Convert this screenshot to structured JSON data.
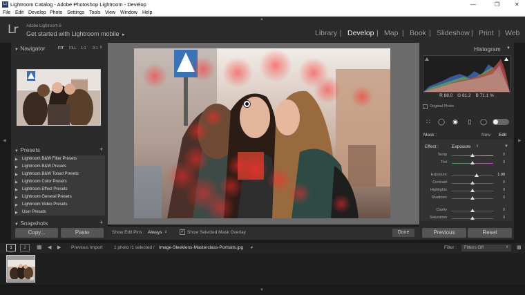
{
  "window": {
    "title": "Lightroom Catalog - Adobe Photoshop Lightroom - Develop",
    "app_icon": "Lr",
    "controls": [
      "minimize-icon",
      "restore-icon",
      "close-icon"
    ]
  },
  "menu": [
    "File",
    "Edit",
    "Develop",
    "Photo",
    "Settings",
    "Tools",
    "View",
    "Window",
    "Help"
  ],
  "identity": {
    "logo": "Lr",
    "version": "Adobe Lightroom 6",
    "mobile": "Get started with Lightroom mobile",
    "mobile_arrow": "▸"
  },
  "modules": {
    "library": "Library",
    "develop": "Develop",
    "map": "Map",
    "book": "Book",
    "slideshow": "Slideshow",
    "print": "Print",
    "web": "Web",
    "separator": "|"
  },
  "navigator": {
    "title": "Navigator",
    "fit": "FIT",
    "fill": "FILL",
    "one_to_one": "1:1",
    "ratio": "3:1"
  },
  "presets": {
    "title": "Presets",
    "items": [
      "Lightroom B&W Filter Presets",
      "Lightroom B&W Presets",
      "Lightroom B&W Toned Presets",
      "Lightroom Color Presets",
      "Lightroom Effect Presets",
      "Lightroom General Presets",
      "Lightroom Video Presets",
      "User Presets"
    ],
    "add": "+"
  },
  "snapshots": {
    "title": "Snapshots",
    "add": "+"
  },
  "left_buttons": {
    "copy": "Copy...",
    "paste": "Paste"
  },
  "toolbar": {
    "show_edit_pins_label": "Show Edit Pins :",
    "edit_pins_value": "Always",
    "overlay_label": "Show Selected Mask Overlay",
    "done": "Done"
  },
  "histogram": {
    "title": "Histogram",
    "r_label": "R",
    "r_value": "88.0",
    "g_label": "G",
    "g_value": "81.2",
    "b_label": "B",
    "b_value": "71.1",
    "percent": "%",
    "original_photo": "Original Photo"
  },
  "mask": {
    "label": "Mask :",
    "new": "New",
    "edit": "Edit"
  },
  "effect": {
    "label": "Effect :",
    "value": "Exposure",
    "sliders": [
      {
        "name": "Temp",
        "value": "0",
        "position": 0.5
      },
      {
        "name": "Tint",
        "value": "0",
        "position": 0.5
      },
      {
        "name": "Exposure",
        "value": "1.00",
        "position": 0.6
      },
      {
        "name": "Contrast",
        "value": "0",
        "position": 0.5
      },
      {
        "name": "Highlights",
        "value": "0",
        "position": 0.5
      },
      {
        "name": "Shadows",
        "value": "0",
        "position": 0.5
      },
      {
        "name": "Clarity",
        "value": "0",
        "position": 0.5
      },
      {
        "name": "Saturation",
        "value": "0",
        "position": 0.5
      }
    ]
  },
  "right_buttons": {
    "previous": "Previous",
    "reset": "Reset"
  },
  "filmstrip": {
    "page1": "1",
    "page2": "2",
    "previous_import": "Previous Import",
    "selection_info": "1 photo /1 selected /",
    "filename": "Image-Sleeklens-Masterclass-Portraits.jpg",
    "filter_label": "Filter :",
    "filter_value": "Filters Off"
  }
}
